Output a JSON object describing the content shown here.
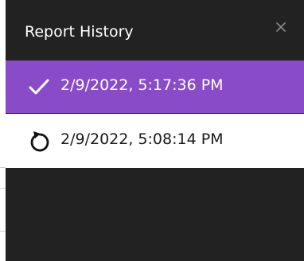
{
  "panel": {
    "title": "Report History",
    "close_icon": "close-icon"
  },
  "history": {
    "items": [
      {
        "label": "2/9/2022, 5:17:36 PM",
        "icon": "checkmark-icon",
        "selected": true
      },
      {
        "label": "2/9/2022, 5:08:14 PM",
        "icon": "restore-icon",
        "selected": false
      }
    ]
  },
  "colors": {
    "panel_background": "#222222",
    "selected_background": "#8a4bc8",
    "item_background": "#ffffff"
  }
}
